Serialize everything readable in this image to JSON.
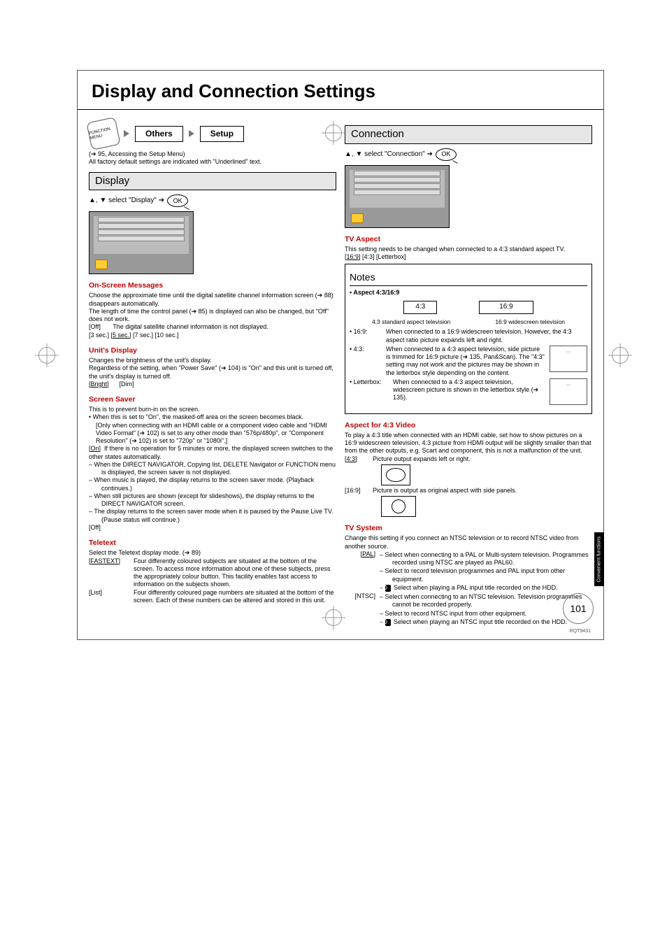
{
  "title": "Display and Connection Settings",
  "nav": {
    "others": "Others",
    "setup": "Setup"
  },
  "intro": {
    "ref": "(➔ 95, Accessing the Setup Menu)",
    "factory": "All factory default settings are indicated with \"Underlined\" text."
  },
  "display": {
    "header": "Display",
    "select": "▲, ▼ select \"Display\" ➔",
    "ok": "OK"
  },
  "osm": {
    "heading": "On-Screen Messages",
    "p1": "Choose the approximate time until the digital satellite channel information screen (➔ 88) disappears automatically.",
    "p2": "The length of time the control panel (➔ 85) is displayed can also be changed, but \"Off\" does not work.",
    "off_label": "[Off]",
    "off_desc": "The digital satellite channel information is not displayed.",
    "opts": "[3 sec.] [5 sec.] [7 sec.] [10 sec.]",
    "opt_default": "5 sec."
  },
  "unitdisp": {
    "heading": "Unit's Display",
    "p1": "Changes the brightness of the unit's display.",
    "p2": "Regardless of the setting, when \"Power Save\" (➔ 104) is \"On\" and this unit is turned off, the unit's display is turned off.",
    "opt1": "[Bright]",
    "opt2": "[Dim]"
  },
  "saver": {
    "heading": "Screen Saver",
    "p1": "This is to prevent burn-in on the screen.",
    "b1": "When this is set to \"On\", the masked-off area on the screen becomes black.",
    "b1a": "[Only when connecting with an HDMI cable or a component video cable and \"HDMI Video Format\" (➔ 102) is set to any other mode than \"576p/480p\", or \"Component Resolution\" (➔ 102) is set to \"720p\" or \"1080i\".]",
    "on_label": "[On]",
    "on_desc": "If there is no operation for 5 minutes or more, the displayed screen switches to the other states automatically.",
    "d1": "When the DIRECT NAVIGATOR, Copying list, DELETE Navigator or FUNCTION menu is displayed, the screen saver is not displayed.",
    "d2": "When music is played, the display returns to the screen saver mode. (Playback continues.)",
    "d3": "When still pictures are shown (except for slideshows), the display returns to the DIRECT NAVIGATOR screen.",
    "d4": "The display returns to the screen saver mode when it is paused by the Pause Live TV. (Pause status will continue.)",
    "off": "[Off]"
  },
  "teletext": {
    "heading": "Teletext",
    "p1": "Select the Teletext display mode. (➔ 89)",
    "f_label": "[FASTEXT]",
    "f_desc": "Four differently coloured subjects are situated at the bottom of the screen. To access more information about one of these subjects, press the appropriately colour button. This facility enables fast access to information on the subjects shown.",
    "l_label": "[List]",
    "l_desc": "Four differently coloured page numbers are situated at the bottom of the screen. Each of these numbers can be altered and stored in this unit."
  },
  "connection": {
    "header": "Connection",
    "select": "▲, ▼ select \"Connection\" ➔",
    "ok": "OK"
  },
  "tvaspect": {
    "heading": "TV Aspect",
    "p1": "This setting needs to be changed when connected to a 4:3 standard aspect TV.",
    "opts": "[16:9] [4:3] [Letterbox]",
    "default": "16:9"
  },
  "notes": {
    "header": "Notes",
    "bullet": "Aspect 4:3/16:9",
    "box43": "4:3",
    "box169": "16:9",
    "lab43": "4:3 standard aspect television",
    "lab169": "16:9 widescreen television",
    "l1_tag": "• 16:9:",
    "l1": "When connected to a 16:9 widescreen television. However, the 4:3 aspect ratio picture expands left and right.",
    "l2_tag": "• 4:3:",
    "l2": "When connected to a 4:3 aspect television, side picture is trimmed for 16:9 picture (➔ 135, Pan&Scan). The \"4:3\" setting may not work and the pictures may be shown in the letterbox style depending on the content.",
    "l3_tag": "• Letterbox:",
    "l3": "When connected to a 4:3 aspect television, widescreen picture is shown in the letterbox style (➔ 135)."
  },
  "aspect43": {
    "heading": "Aspect for 4:3 Video",
    "p1": "To play a 4:3 title when connected with an HDMI cable, set how to show pictures on a 16:9 widescreen television. 4:3 picture from HDMI output will be slightly smaller than that from the other outputs, e.g. Scart and component, this is not a malfunction of the unit.",
    "o1_tag": "[4:3]",
    "o1": "Picture output expands left or right.",
    "o2_tag": "[16:9]",
    "o2": "Picture is output as original aspect with side panels."
  },
  "tvsystem": {
    "heading": "TV System",
    "p1": "Change this setting if you connect an NTSC television or to record NTSC video from another source.",
    "pal_tag": "[PAL]",
    "pal_d1": "Select when connecting to a PAL or Multi-system television. Programmes recorded using NTSC are played as PAL60.",
    "pal_d2": "Select to record television programmes and PAL input from other equipment.",
    "pal_d3a": "HDD",
    "pal_d3": "Select when playing a PAL input title recorded on the HDD.",
    "ntsc_tag": "[NTSC]",
    "ntsc_d1": "Select when connecting to an NTSC television. Television programmes cannot be recorded properly.",
    "ntsc_d2": "Select to record NTSC input from other equipment.",
    "ntsc_d3a": "HDD",
    "ntsc_d3": "Select when playing an NTSC input title recorded on the HDD."
  },
  "side_tab": "Convenient functions",
  "page_num": "101",
  "doc_code": "RQT9431"
}
